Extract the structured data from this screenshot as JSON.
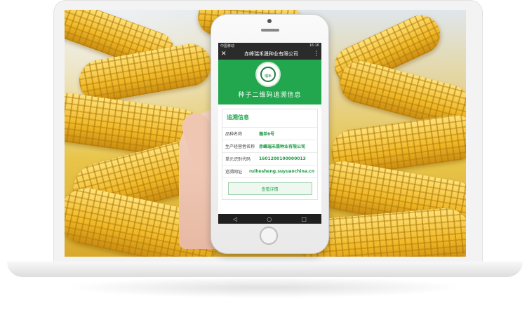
{
  "phone_status": {
    "left": "中国移动 ",
    "right": "16:16"
  },
  "topbar": {
    "close_icon": "close-icon",
    "title": "赤峰瑞禾晟种业有限公司",
    "more_icon": "more-vert-icon"
  },
  "hero": {
    "logo_text": "瑞禾",
    "title": "种子二维码追溯信息"
  },
  "trace": {
    "section_title": "追溯信息",
    "rows": [
      {
        "label": "品种名称",
        "value": "瀚单6号"
      },
      {
        "label": "生产经营者名称",
        "value": "赤峰瑞禾晟种业有限公司"
      },
      {
        "label": "单元识别代码",
        "value": "1601200100000013"
      },
      {
        "label": "追溯网址",
        "value": "ruihesheng.suyuanchina.cn"
      }
    ],
    "button_label": "查看详情"
  },
  "navbar": {
    "back": "◁",
    "home": "○",
    "recent": "□"
  }
}
